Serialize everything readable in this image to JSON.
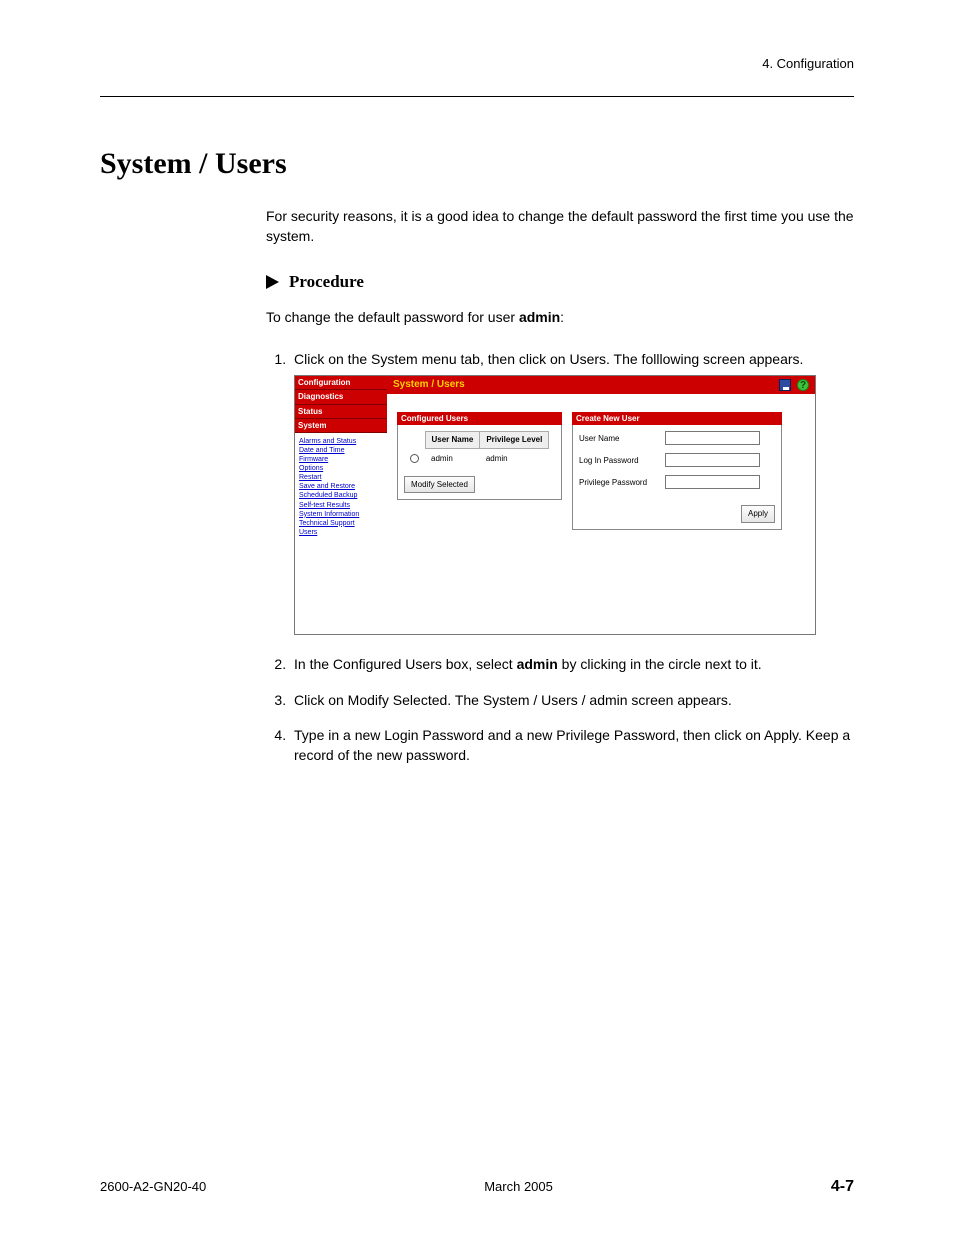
{
  "header": {
    "chapter": "4. Configuration"
  },
  "title": "System / Users",
  "intro": "For security reasons, it is a good idea to change the default password the first time you use the system.",
  "procedure_label": "Procedure",
  "intro2_prefix": "To change the default password for user ",
  "intro2_bold": "admin",
  "intro2_suffix": ":",
  "steps": {
    "s1": "Click on the System menu tab, then click on Users. The folllowing screen appears.",
    "s2_prefix": "In the Configured Users box, select ",
    "s2_bold": "admin",
    "s2_suffix": " by clicking in the circle next to it.",
    "s3": "Click on Modify Selected. The System / Users / admin screen appears.",
    "s4": "Type in a new Login Password and a new Privilege Password, then click on Apply. Keep a record of the new password."
  },
  "screenshot": {
    "nav_headers": [
      "Configuration",
      "Diagnostics",
      "Status",
      "System"
    ],
    "nav_links": [
      "Alarms and Status",
      "Date and Time",
      "Firmware",
      "Options",
      "Restart",
      "Save and Restore",
      "Scheduled Backup",
      "Self-test Results",
      "System Information",
      "Technical Support",
      "Users"
    ],
    "titlebar": "System / Users",
    "configured_users": {
      "title": "Configured Users",
      "col1": "User Name",
      "col2": "Privilege Level",
      "row_user": "admin",
      "row_priv": "admin",
      "modify_btn": "Modify Selected"
    },
    "create_new_user": {
      "title": "Create New User",
      "f1": "User Name",
      "f2": "Log In Password",
      "f3": "Privilege Password",
      "apply_btn": "Apply"
    }
  },
  "footer": {
    "left": "2600-A2-GN20-40",
    "center": "March 2005",
    "right": "4-7"
  }
}
